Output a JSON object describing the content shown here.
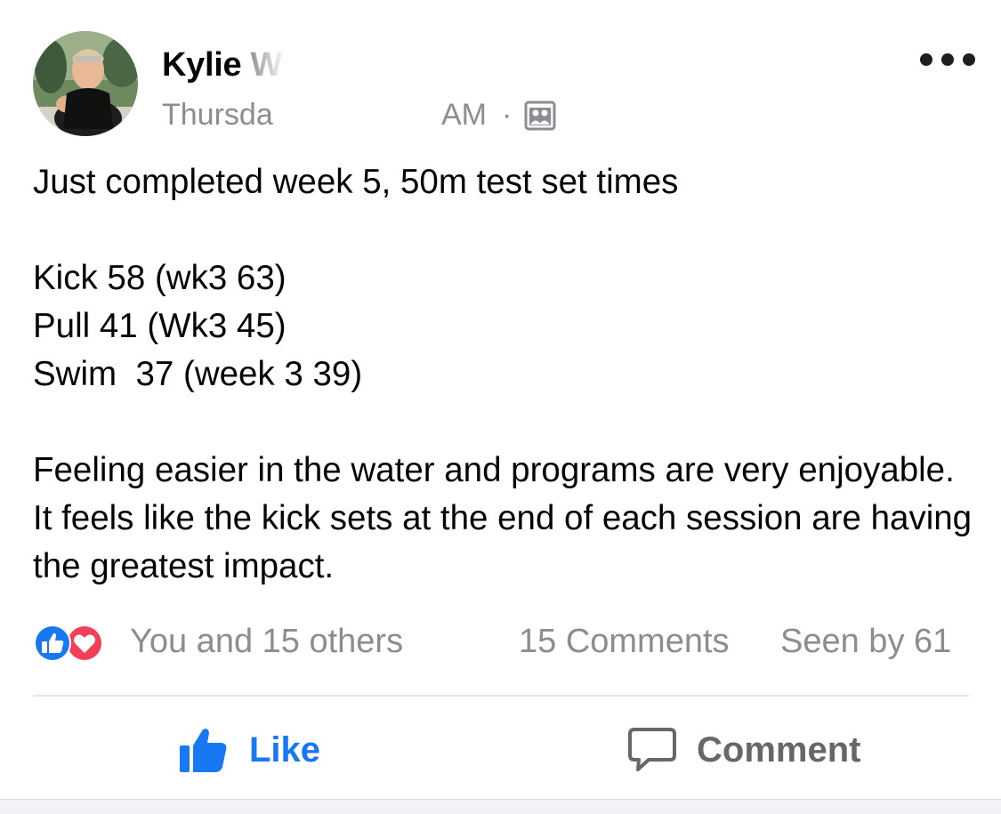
{
  "post": {
    "author": "Kylie W",
    "timestamp_visible": "Thursda",
    "timestamp_time": "AM",
    "meta_separator": "·",
    "audience_icon": "group-audience-icon",
    "more_icon": "more-options-icon",
    "body": {
      "line1": "Just completed week 5, 50m test set times",
      "line2": "Kick 58 (wk3 63)",
      "line3": "Pull 41 (Wk3 45)",
      "line4": "Swim  37 (week 3 39)",
      "line5": "Feeling easier in the water and programs are very enjoyable. It feels like the kick sets at the end of each session are having the greatest impact."
    }
  },
  "reactions": {
    "icons": [
      "like-reaction-icon",
      "love-reaction-icon"
    ],
    "summary": "You and 15 others",
    "comments": "15 Comments",
    "seen_by": "Seen by 61"
  },
  "actions": {
    "like_label": "Like",
    "comment_label": "Comment"
  },
  "colors": {
    "accent": "#1877f2",
    "love": "#f33e58",
    "muted_text": "#8a8d91",
    "action_text": "#65676b"
  }
}
